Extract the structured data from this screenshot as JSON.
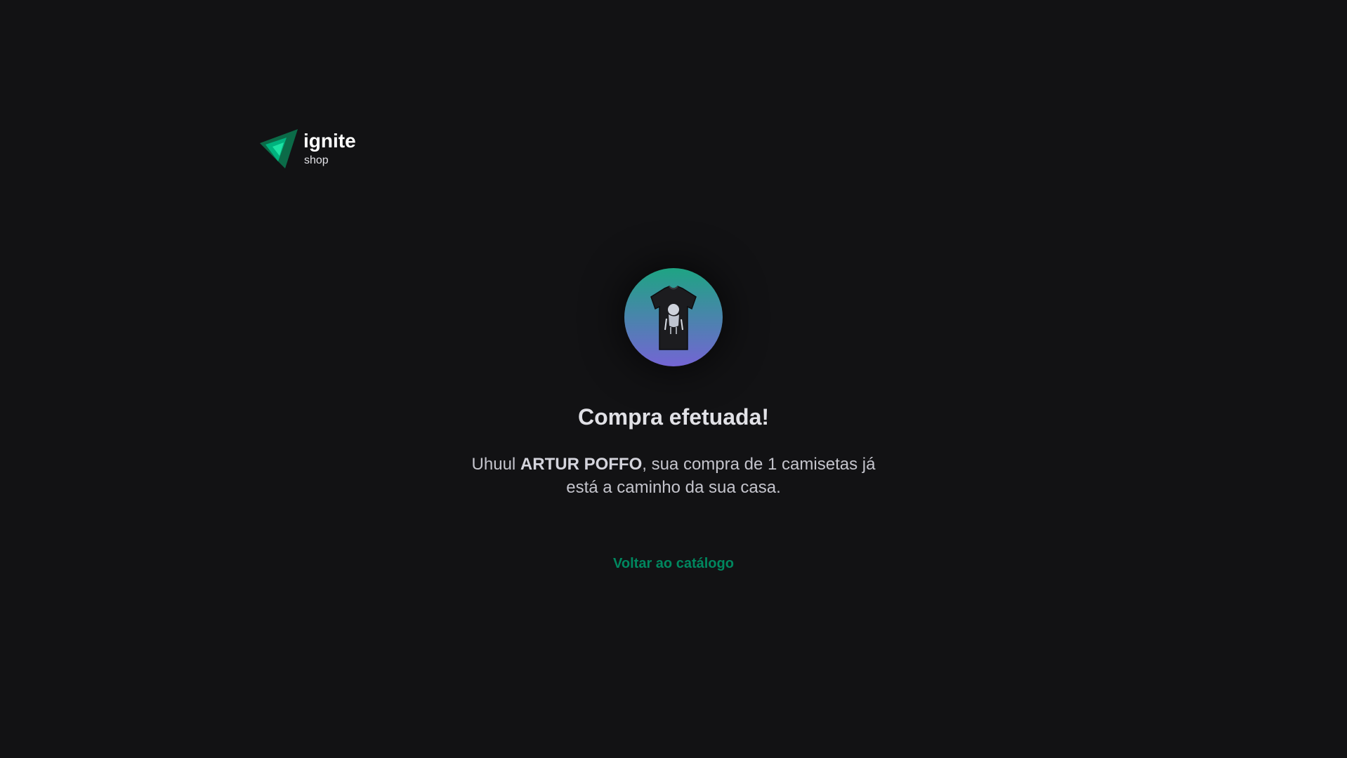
{
  "header": {
    "logo_icon": "ignite-logo-icon",
    "logo_title": "ignite",
    "logo_subtitle": "shop"
  },
  "success": {
    "product_image_icon": "t-shirt-image",
    "title": "Compra efetuada!",
    "message_prefix": "Uhuul ",
    "customer_name": "ARTUR POFFO",
    "message_middle": ", sua compra de ",
    "quantity": "1",
    "message_suffix": " camisetas já está a caminho da sua casa.",
    "back_link_label": "Voltar ao catálogo"
  },
  "colors": {
    "background": "#121214",
    "accent": "#00875f",
    "gradient_start": "#1ea483",
    "gradient_end": "#7465d4",
    "text": "#e1e1e6"
  }
}
